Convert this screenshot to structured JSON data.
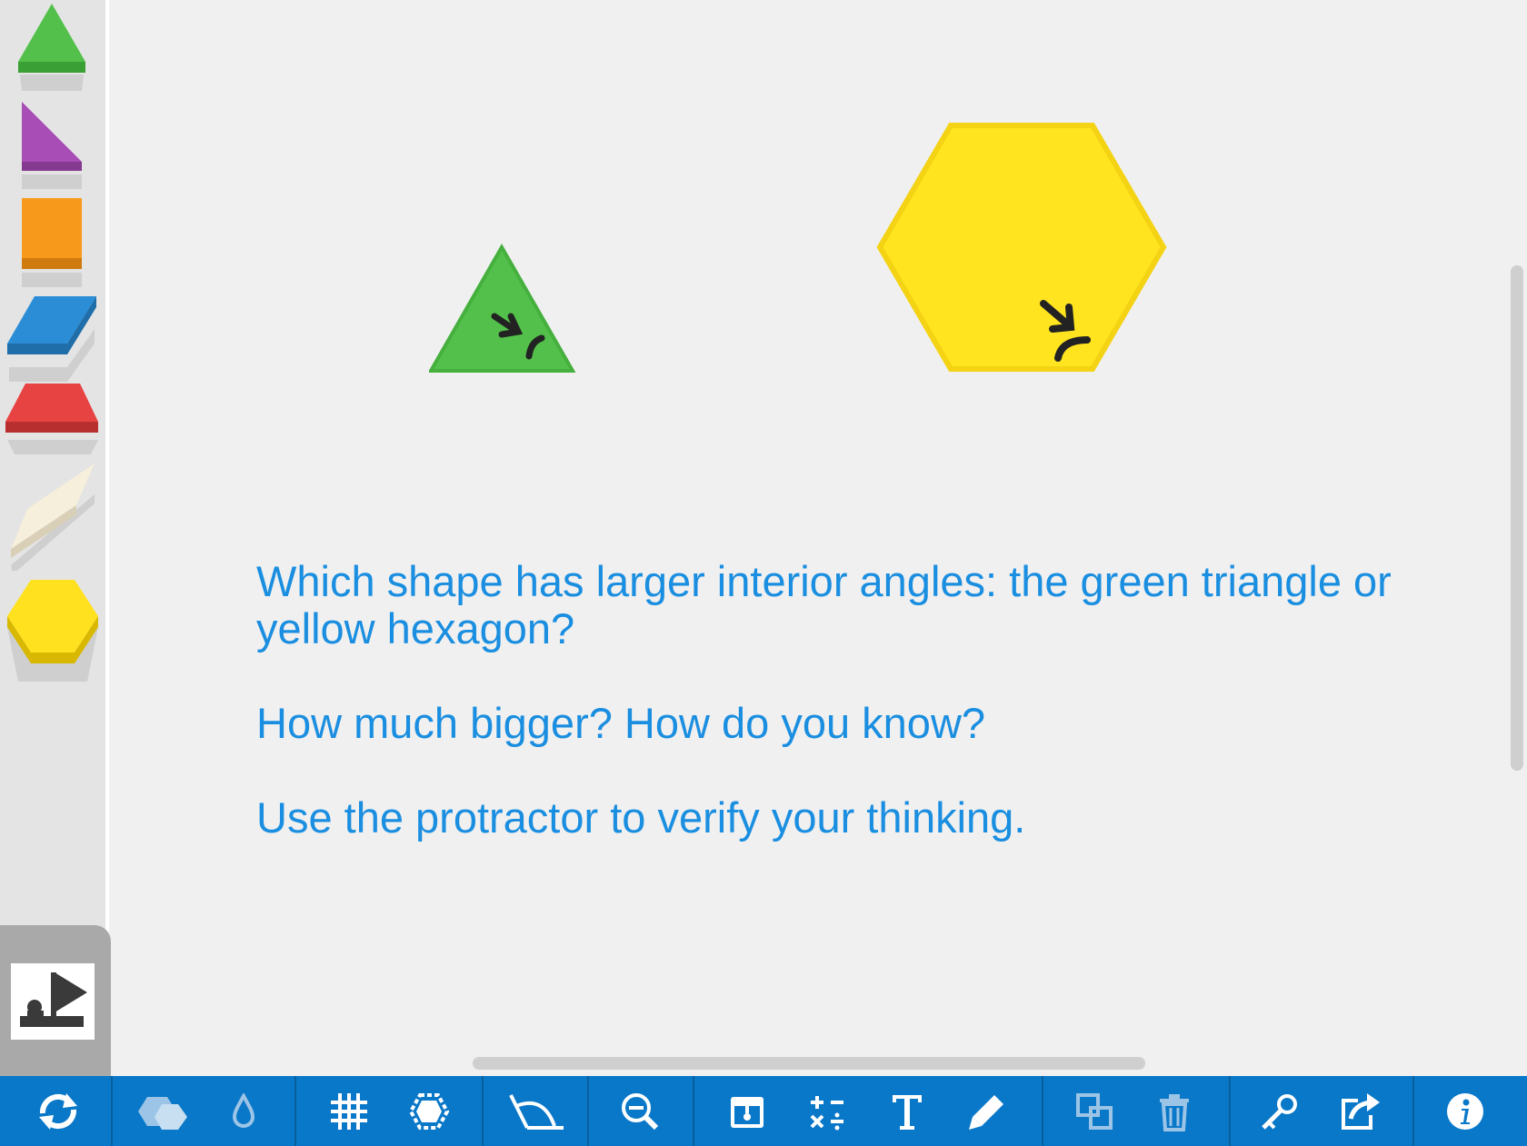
{
  "palette": [
    {
      "name": "green-triangle",
      "color": "#52c04a"
    },
    {
      "name": "purple-right-triangle",
      "color": "#a84cb6"
    },
    {
      "name": "orange-square",
      "color": "#f79a1c"
    },
    {
      "name": "blue-rhombus",
      "color": "#2a8dd6"
    },
    {
      "name": "red-trapezoid",
      "color": "#e84343"
    },
    {
      "name": "tan-thin-rhombus",
      "color": "#f6efdc"
    },
    {
      "name": "yellow-hexagon",
      "color": "#ffe11f"
    }
  ],
  "workspace": {
    "shapes": [
      {
        "name": "green-triangle",
        "color": "#52c04a"
      },
      {
        "name": "yellow-hexagon",
        "color": "#ffe11f"
      }
    ],
    "prompt": {
      "line1": "Which shape has larger interior angles: the green triangle or yellow hexagon?",
      "line2": "How much bigger? How do you know?",
      "line3": "Use the protractor to verify your thinking."
    },
    "text_color": "#1a8ee0"
  },
  "toolbar": {
    "background": "#0a78c8",
    "icons": [
      "refresh-icon",
      "shapes-icon",
      "color-drop-icon",
      "grid-icon",
      "snap-hexagon-icon",
      "protractor-icon",
      "zoom-out-icon",
      "calendar-icon",
      "math-operators-icon",
      "text-icon",
      "pencil-icon",
      "duplicate-icon",
      "trash-icon",
      "key-icon",
      "share-icon",
      "info-icon"
    ]
  }
}
